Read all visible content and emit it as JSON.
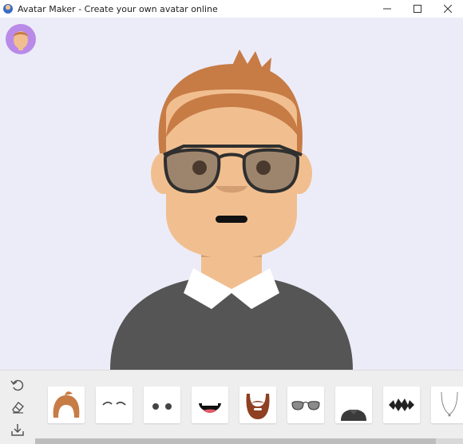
{
  "window": {
    "title": "Avatar Maker - Create your own avatar online",
    "controls": [
      "minimize",
      "maximize",
      "close"
    ]
  },
  "canvas": {
    "background": "#ececf9",
    "preview_button_icon": "avatar-preview-icon"
  },
  "avatar": {
    "skin_color": "#f1bf8f",
    "hair_color": "#c77b45",
    "lens_color": "#8e7a67",
    "frame_color": "#2f2f2f",
    "shirt_color": "#555555",
    "collar_color": "#ffffff"
  },
  "toolbar": {
    "side_tools": [
      "undo-icon",
      "eraser-icon",
      "download-icon"
    ],
    "categories": [
      "hair",
      "eyebrows",
      "eyes",
      "mouth",
      "beard",
      "glasses",
      "clothes",
      "tattoo",
      "accessories"
    ]
  },
  "colors": {
    "toolbar_bg": "#eeeeee",
    "preview_circle": "#b98ae8"
  }
}
